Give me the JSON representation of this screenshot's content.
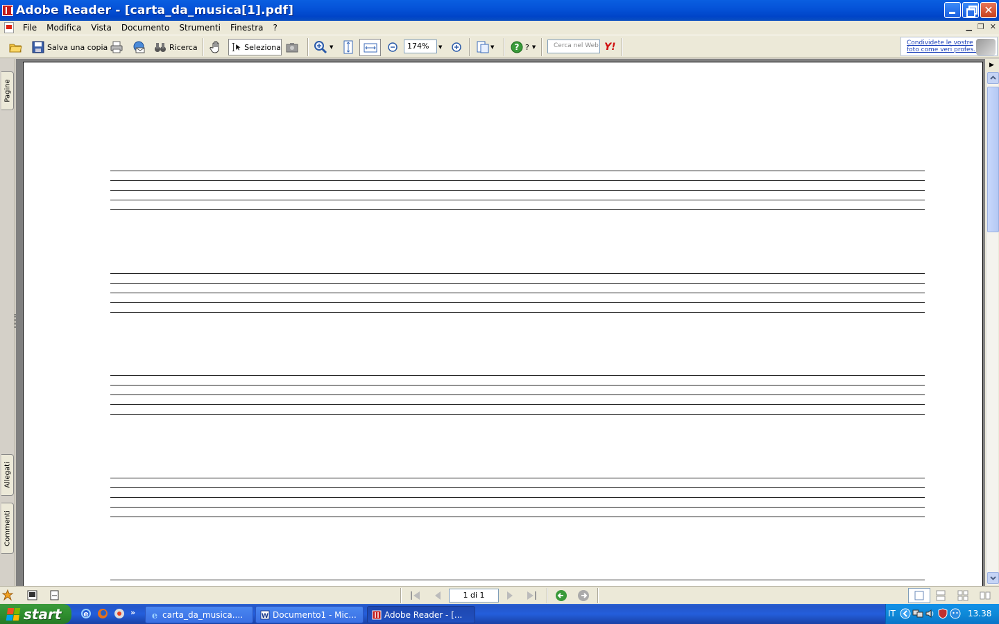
{
  "window": {
    "title": "Adobe Reader - [carta_da_musica[1].pdf]"
  },
  "menu": {
    "items": [
      "File",
      "Modifica",
      "Vista",
      "Documento",
      "Strumenti",
      "Finestra",
      "?"
    ]
  },
  "toolbar": {
    "save_copy_label": "Salva una copia",
    "search_label": "Ricerca",
    "select_label": "Seleziona",
    "zoom_value": "174%",
    "help_label": "?",
    "web_search_placeholder": "Cerca nel Web",
    "yahoo_label": "Y!",
    "ad_line1": "Condividete le vostre",
    "ad_line2": "foto come veri profes..."
  },
  "side_tabs": {
    "pages": "Pagine",
    "attachments": "Allegati",
    "comments": "Commenti"
  },
  "document": {
    "staff_count": 5,
    "lines_per_staff": 5
  },
  "statusbar": {
    "page_indicator": "1 di 1"
  },
  "taskbar": {
    "start_label": "start",
    "tasks": [
      {
        "label": "carta_da_musica...."
      },
      {
        "label": "Documento1 - Mic..."
      },
      {
        "label": "Adobe Reader - [..."
      }
    ],
    "tray_lang": "IT",
    "tray_time": "13.38"
  },
  "colors": {
    "titlebar": "#0553d8",
    "taskbar": "#245edb",
    "start": "#2f8f2f",
    "menu_bg": "#ece9d8"
  }
}
